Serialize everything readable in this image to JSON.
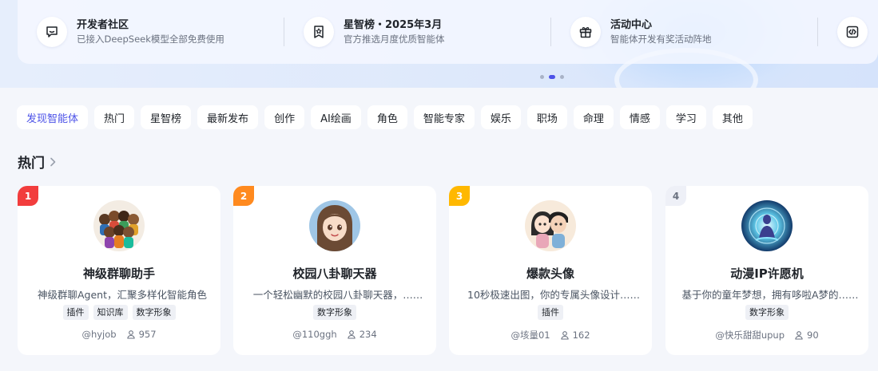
{
  "banner": {
    "items": [
      {
        "title": "开发者社区",
        "subtitle": "已接入DeepSeek模型全部免费使用",
        "icon": "chat-bubble-icon"
      },
      {
        "title": "星智榜・2025年3月",
        "subtitle": "官方推选月度优质智能体",
        "icon": "ribbon-award-icon"
      },
      {
        "title": "活动中心",
        "subtitle": "智能体开发有奖活动阵地",
        "icon": "gift-icon"
      },
      {
        "title": "",
        "subtitle": "",
        "icon": "code-icon"
      }
    ],
    "carousel_active_index": 1,
    "carousel_count": 3
  },
  "tabs": [
    "发现智能体",
    "热门",
    "星智榜",
    "最新发布",
    "创作",
    "AI绘画",
    "角色",
    "智能专家",
    "娱乐",
    "职场",
    "命理",
    "情感",
    "学习",
    "其他"
  ],
  "active_tab": "发现智能体",
  "section": {
    "title": "热门"
  },
  "colors": {
    "accent": "#4d53e8",
    "rank1": "#f23d3d",
    "rank2": "#ff8a1f",
    "rank3": "#ffb800",
    "rank4": "#eef0f7"
  },
  "cards": [
    {
      "rank": "1",
      "name": "神级群聊助手",
      "desc": "神级群聊Agent，汇聚多样化智能角色",
      "tags": [
        "插件",
        "知识库",
        "数字形象"
      ],
      "author": "@hyjob",
      "users": "957"
    },
    {
      "rank": "2",
      "name": "校园八卦聊天器",
      "desc": "一个轻松幽默的校园八卦聊天器，……",
      "tags": [
        "数字形象"
      ],
      "author": "@110ggh",
      "users": "234"
    },
    {
      "rank": "3",
      "name": "爆款头像",
      "desc": "10秒极速出图，你的专属头像设计……",
      "tags": [
        "插件"
      ],
      "author": "@垓量01",
      "users": "162"
    },
    {
      "rank": "4",
      "name": "动漫IP许愿机",
      "desc": "基于你的童年梦想，拥有哆啦A梦的……",
      "tags": [
        "数字形象"
      ],
      "author": "@快乐甜甜upup",
      "users": "90"
    }
  ]
}
